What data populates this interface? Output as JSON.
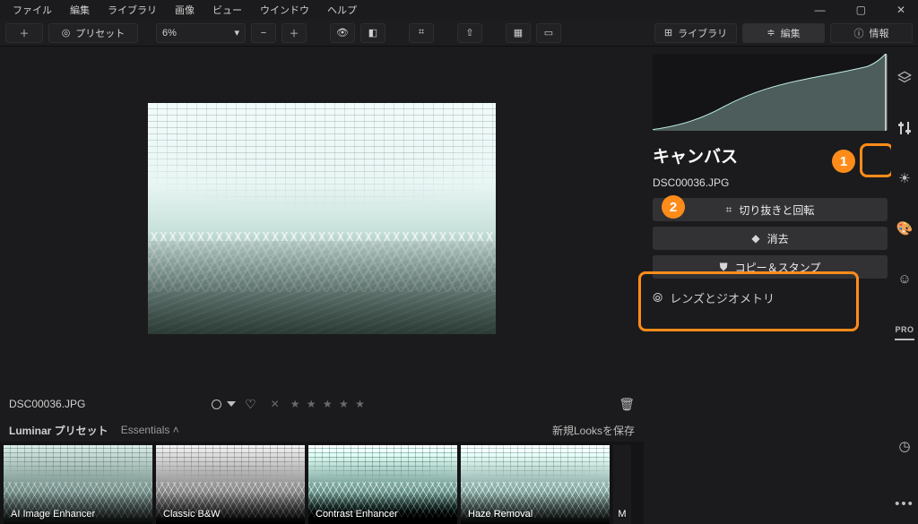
{
  "menu": [
    "ファイル",
    "編集",
    "ライブラリ",
    "画像",
    "ビュー",
    "ウインドウ",
    "ヘルプ"
  ],
  "toolbar": {
    "preset_label": "プリセット",
    "zoom": "6%",
    "tabs": {
      "library": "ライブラリ",
      "edit": "編集",
      "info": "情報"
    }
  },
  "image": {
    "filename": "DSC00036.JPG"
  },
  "rating": {
    "stars": "★ ★ ★ ★ ★"
  },
  "presetbar": {
    "title": "Luminar プリセット",
    "group": "Essentials",
    "save": "新規Looksを保存"
  },
  "presets": [
    {
      "label": "AI Image Enhancer",
      "cls": ""
    },
    {
      "label": "Classic B&W",
      "cls": "bw"
    },
    {
      "label": "Contrast Enhancer",
      "cls": "ce"
    },
    {
      "label": "Haze Removal",
      "cls": "hz"
    },
    {
      "label": "M",
      "cls": "more"
    }
  ],
  "panel": {
    "title": "キャンバス",
    "filename": "DSC00036.JPG",
    "crop": "切り抜きと回転",
    "erase": "消去",
    "clone": "コピー＆スタンプ",
    "lens": "レンズとジオメトリ"
  },
  "pro": "PRO",
  "annot": {
    "1": "1",
    "2": "2"
  }
}
